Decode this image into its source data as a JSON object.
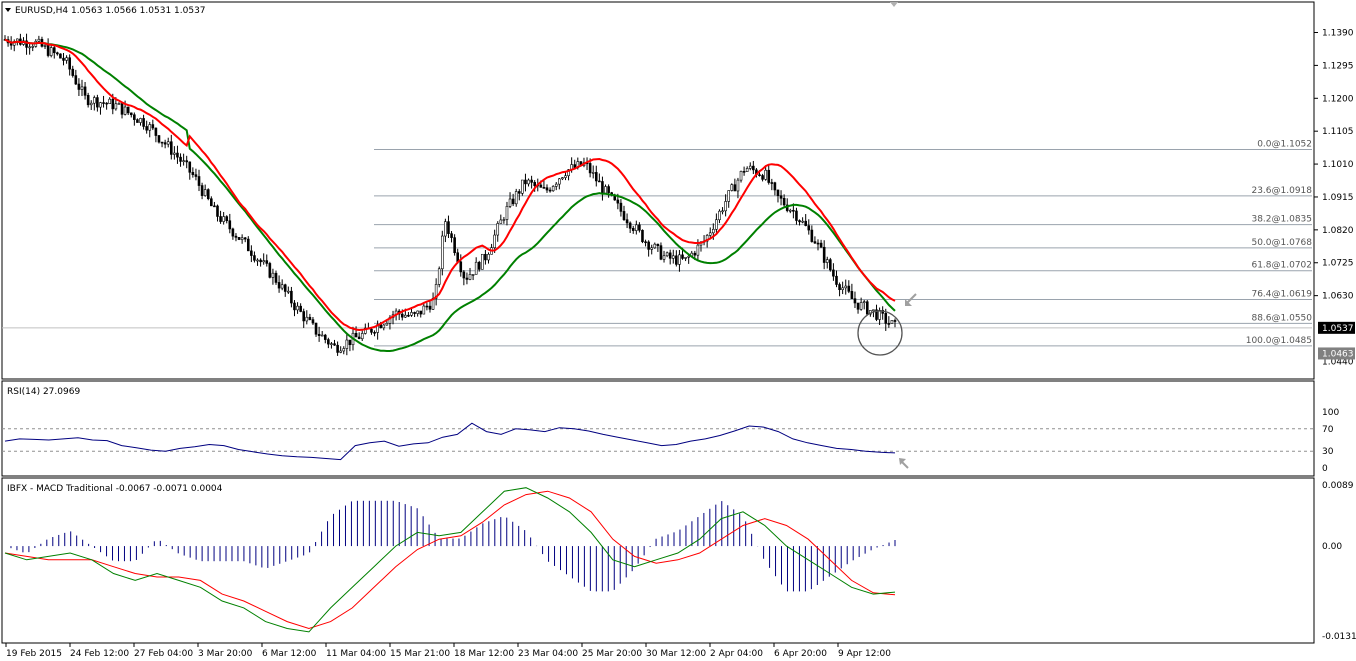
{
  "header": {
    "title": "EURUSD,H4  1.0563 1.0566 1.0531 1.0537",
    "rsi_label": "RSI(14) 27.0969",
    "macd_label": "IBFX - MACD Traditional -0.0067 -0.0071 0.0004"
  },
  "colors": {
    "candle": "#000000",
    "ma_fast": "#ff0000",
    "ma_slow": "#008000",
    "ma_alt": "#ffff00",
    "rsi_line": "#000080",
    "macd_main": "#008000",
    "macd_signal": "#ff0000",
    "histogram": "#000080",
    "fib_line": "#9aa3ad",
    "arrow": "#a0a0a0"
  },
  "icons": {
    "menu": "triangle-down-icon",
    "pointer": "arrow-icon",
    "highlight": "circle-marker"
  },
  "chart_data": {
    "type": "candlestick",
    "symbol": "EURUSD",
    "timeframe": "H4",
    "ohlc_current": {
      "open": 1.0563,
      "high": 1.0566,
      "low": 1.0531,
      "close": 1.0537
    },
    "price_axis": {
      "range": [
        1.0395,
        1.1455
      ],
      "ticks": [
        "1.1390",
        "1.1295",
        "1.1200",
        "1.1105",
        "1.1010",
        "1.0915",
        "1.0820",
        "1.0725",
        "1.0630"
      ],
      "current_price": "1.0537",
      "second_marker": "1.0463",
      "bottom_tick": "1.0440"
    },
    "time_axis": {
      "labels": [
        "19 Feb 2015",
        "24 Feb 12:00",
        "27 Feb 04:00",
        "3 Mar 20:00",
        "6 Mar 12:00",
        "11 Mar 04:00",
        "15 Mar 21:00",
        "18 Mar 12:00",
        "23 Mar 04:00",
        "25 Mar 20:00",
        "30 Mar 12:00",
        "2 Apr 04:00",
        "6 Apr 20:00",
        "9 Apr 12:00"
      ]
    },
    "price_path": [
      [
        0,
        1.137
      ],
      [
        3,
        1.136
      ],
      [
        6,
        1.131
      ],
      [
        8,
        1.12
      ],
      [
        11,
        1.118
      ],
      [
        14,
        1.113
      ],
      [
        17,
        1.104
      ],
      [
        19,
        1.097
      ],
      [
        21,
        1.087
      ],
      [
        24,
        1.078
      ],
      [
        27,
        1.068
      ],
      [
        29,
        1.06
      ],
      [
        31,
        1.053
      ],
      [
        33,
        1.048
      ],
      [
        36,
        1.052
      ],
      [
        39,
        1.058
      ],
      [
        41,
        1.057
      ],
      [
        43,
        1.062
      ],
      [
        44,
        1.085
      ],
      [
        46,
        1.068
      ],
      [
        48,
        1.074
      ],
      [
        50,
        1.087
      ],
      [
        52,
        1.096
      ],
      [
        54,
        1.093
      ],
      [
        56,
        1.099
      ],
      [
        58,
        1.101
      ],
      [
        60,
        1.093
      ],
      [
        62,
        1.086
      ],
      [
        64,
        1.079
      ],
      [
        66,
        1.074
      ],
      [
        68,
        1.073
      ],
      [
        70,
        1.079
      ],
      [
        72,
        1.09
      ],
      [
        74,
        1.1
      ],
      [
        76,
        1.098
      ],
      [
        77,
        1.092
      ],
      [
        79,
        1.087
      ],
      [
        81,
        1.079
      ],
      [
        83,
        1.068
      ],
      [
        85,
        1.061
      ],
      [
        87,
        1.058
      ],
      [
        89,
        1.054
      ]
    ],
    "fibonacci": [
      {
        "label": "0.0@1.1052",
        "level": 1.1052
      },
      {
        "label": "23.6@1.0918",
        "level": 1.0918
      },
      {
        "label": "38.2@1.0835",
        "level": 1.0835
      },
      {
        "label": "50.0@1.0768",
        "level": 1.0768
      },
      {
        "label": "61.8@1.0702",
        "level": 1.0702
      },
      {
        "label": "76.4@1.0619",
        "level": 1.0619
      },
      {
        "label": "88.6@1.0550",
        "level": 1.055
      },
      {
        "label": "100.0@1.0485",
        "level": 1.0485
      }
    ],
    "rsi": {
      "period": 14,
      "value": 27.0969,
      "ticks": [
        "100",
        "70",
        "30",
        "0"
      ],
      "levels": [
        70,
        30
      ],
      "values": [
        48,
        52,
        51,
        50,
        52,
        54,
        50,
        49,
        40,
        36,
        32,
        30,
        35,
        38,
        42,
        40,
        33,
        29,
        25,
        22,
        20,
        19,
        17,
        15,
        40,
        45,
        48,
        39,
        43,
        45,
        55,
        60,
        80,
        65,
        60,
        70,
        68,
        65,
        72,
        70,
        66,
        60,
        55,
        50,
        45,
        40,
        42,
        48,
        52,
        58,
        66,
        75,
        73,
        65,
        52,
        45,
        40,
        35,
        33,
        30,
        28,
        27
      ]
    },
    "macd": {
      "main": -0.0067,
      "signal": -0.0071,
      "histogram": 0.0004,
      "ticks": [
        "0.0089",
        "0.00",
        "-0.0131"
      ],
      "main_values": [
        -0.001,
        -0.002,
        -0.0015,
        -0.001,
        -0.002,
        -0.004,
        -0.005,
        -0.004,
        -0.005,
        -0.006,
        -0.008,
        -0.009,
        -0.011,
        -0.012,
        -0.0125,
        -0.009,
        -0.006,
        -0.003,
        0.0,
        0.002,
        0.0015,
        0.002,
        0.005,
        0.008,
        0.0085,
        0.007,
        0.005,
        0.002,
        -0.002,
        -0.003,
        -0.002,
        -0.001,
        0.001,
        0.004,
        0.005,
        0.003,
        0.0,
        -0.002,
        -0.004,
        -0.006,
        -0.007,
        -0.0067
      ],
      "signal_values": [
        -0.001,
        -0.0015,
        -0.002,
        -0.002,
        -0.002,
        -0.003,
        -0.004,
        -0.0045,
        -0.0045,
        -0.005,
        -0.007,
        -0.008,
        -0.0095,
        -0.011,
        -0.012,
        -0.011,
        -0.009,
        -0.006,
        -0.003,
        -0.0005,
        0.001,
        0.0015,
        0.0035,
        0.006,
        0.0075,
        0.008,
        0.007,
        0.005,
        0.001,
        -0.0015,
        -0.0025,
        -0.002,
        -0.001,
        0.001,
        0.003,
        0.004,
        0.003,
        0.001,
        -0.002,
        -0.005,
        -0.0068,
        -0.0071
      ]
    }
  }
}
